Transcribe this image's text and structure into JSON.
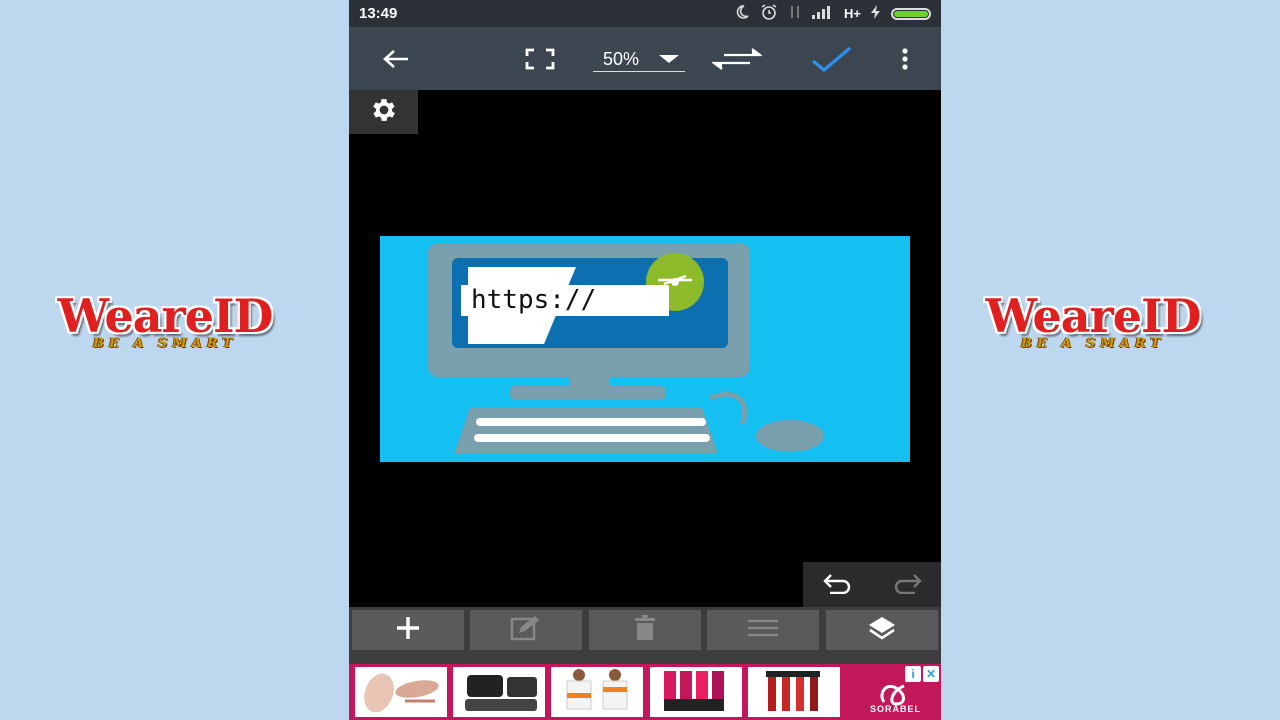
{
  "watermark": {
    "name": "WeareID",
    "tagline": "BE A SMART"
  },
  "status_bar": {
    "time": "13:49",
    "network": "H+"
  },
  "toolbar": {
    "zoom": "50%",
    "icons": [
      "back-arrow-icon",
      "fullscreen-icon",
      "swap-arrows-icon",
      "check-icon",
      "more-vert-icon"
    ],
    "check_color": "#2f8ff0"
  },
  "canvas": {
    "artwork_text": "https://",
    "artwork_bg": "#14bff1"
  },
  "edit_bar": {
    "icons": [
      "add-icon",
      "edit-icon",
      "delete-icon",
      "menu-lines-icon",
      "layers-icon"
    ]
  },
  "ad": {
    "brand": "SORABEL",
    "badges": [
      "i",
      "✕"
    ],
    "accent": "#c2185b"
  }
}
